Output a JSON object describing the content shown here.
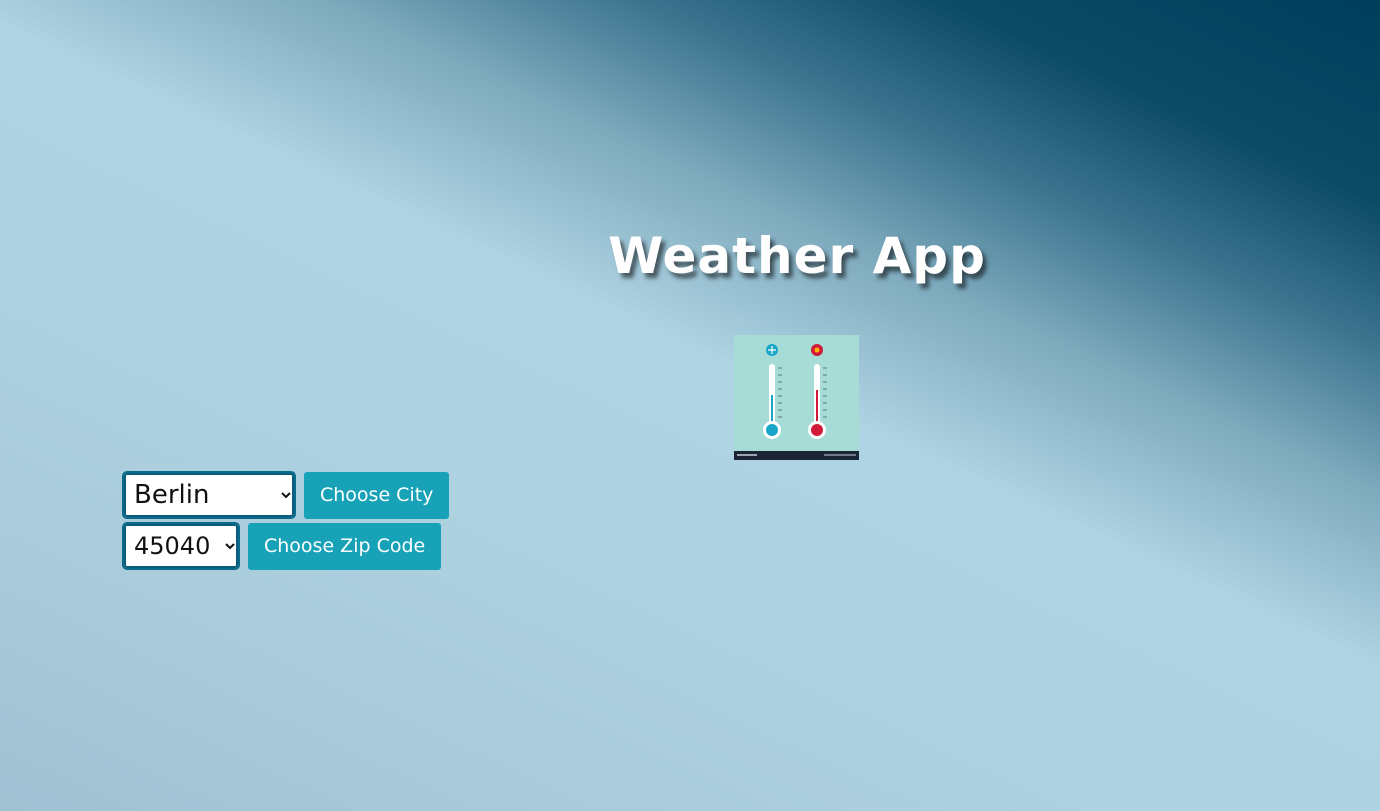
{
  "header": {
    "title": "Weather App"
  },
  "image": {
    "alt": "thermometer-illustration"
  },
  "city_form": {
    "selected_city": "Berlin",
    "button_label": "Choose City"
  },
  "zip_form": {
    "selected_zip": "45040",
    "button_label": "Choose Zip Code"
  },
  "colors": {
    "button_bg": "#17a2b8",
    "select_border": "#0a6a8a",
    "title_color": "#ffffff"
  }
}
